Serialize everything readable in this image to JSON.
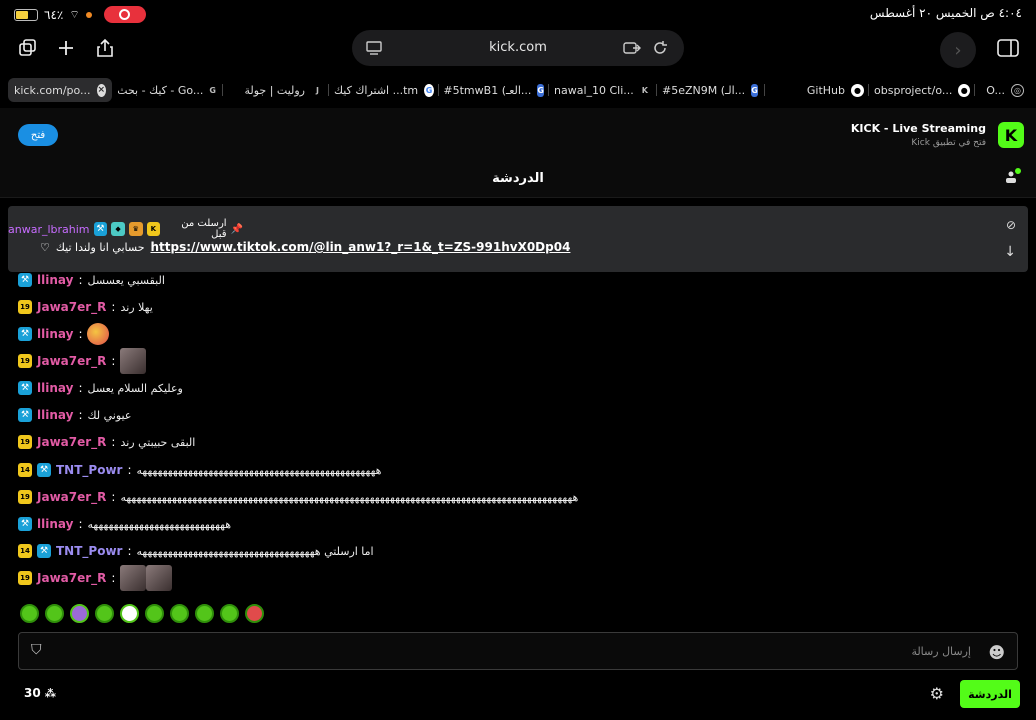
{
  "status_bar": {
    "battery": "٦٤٪",
    "battery_level": 0.64,
    "datetime": "٤:٠٤ ص  الخميس ٢٠ أغسطس"
  },
  "toolbar": {
    "url": "kick.com"
  },
  "tabs": [
    {
      "label": "kick.com/po...",
      "active": true
    },
    {
      "label": "كيك - بحث - Go...",
      "icon": "G"
    },
    {
      "label": "روليت | جولة",
      "icon": "J"
    },
    {
      "label": "اشتراك كيك ...tm",
      "icon": "G"
    },
    {
      "label": "#5tmwB1 (العـ...",
      "icon": "G"
    },
    {
      "label": "nawal_10 Cli...",
      "icon": "K"
    },
    {
      "label": "#5eZN9M (الـ...",
      "icon": "G"
    },
    {
      "label": "GitHub",
      "icon": "gh"
    },
    {
      "label": "obsproject/o...",
      "icon": "gh"
    },
    {
      "label": "O...",
      "icon": "O"
    }
  ],
  "banner": {
    "open_label": "فتح",
    "title": "KICK - Live Streaming",
    "subtitle": "فتح في تطبيق Kick"
  },
  "chat": {
    "title": "الدردشة"
  },
  "pinned": {
    "label": "ارسلت من قبل",
    "username": "anwar_lbrahim",
    "link": "https://www.tiktok.com/@lin_anw1?_r=1&_t=ZS-991hvX0Dp04",
    "text": "حسابي انا ولندا تيك"
  },
  "messages": [
    {
      "user": "llinay",
      "color": "#e25ba5",
      "badge": "mod",
      "text": "البقسبي يعسسل"
    },
    {
      "user": "Jawa7er_R",
      "color": "#e25ba5",
      "badge": "sub",
      "text": "يهلا رند"
    },
    {
      "user": "llinay",
      "color": "#e25ba5",
      "badge": "mod",
      "text": "",
      "emote": "round"
    },
    {
      "user": "Jawa7er_R",
      "color": "#e25ba5",
      "badge": "sub",
      "text": "",
      "emote": "img"
    },
    {
      "user": "llinay",
      "color": "#e25ba5",
      "badge": "mod",
      "text": "وعليكم السلام يعسل"
    },
    {
      "user": "llinay",
      "color": "#e25ba5",
      "badge": "mod",
      "text": "عيوني لك"
    },
    {
      "user": "Jawa7er_R",
      "color": "#e25ba5",
      "badge": "sub",
      "text": "البقى حبيبتي رند"
    },
    {
      "user": "TNT_Powr",
      "color": "#9b8cf0",
      "badge": "sub14",
      "text": "هههههههههههههههههههههههههههههههههههههههههههههههه"
    },
    {
      "user": "Jawa7er_R",
      "color": "#e25ba5",
      "badge": "sub",
      "text": "هههههههههههههههههههههههههههههههههههههههههههههههههههههههههههههههههههههههههههههههههههههههههه"
    },
    {
      "user": "llinay",
      "color": "#e25ba5",
      "badge": "mod",
      "text": "هههههههههههههههههههههههههههه"
    },
    {
      "user": "TNT_Powr",
      "color": "#9b8cf0",
      "badge": "sub14",
      "text": "اما ارسلتي هههههههههههههههههههههههههههههههههههه"
    },
    {
      "user": "Jawa7er_R",
      "color": "#e25ba5",
      "badge": "sub",
      "text": "",
      "emote": "img2"
    }
  ],
  "input": {
    "placeholder": "إرسال رسالة"
  },
  "footer": {
    "viewer_count": "30",
    "chat_button": "الدردشة"
  },
  "colors": {
    "accent": "#53fc18",
    "pinned_bg": "#2a2b2d",
    "mod_badge": "#1aa1d8"
  }
}
